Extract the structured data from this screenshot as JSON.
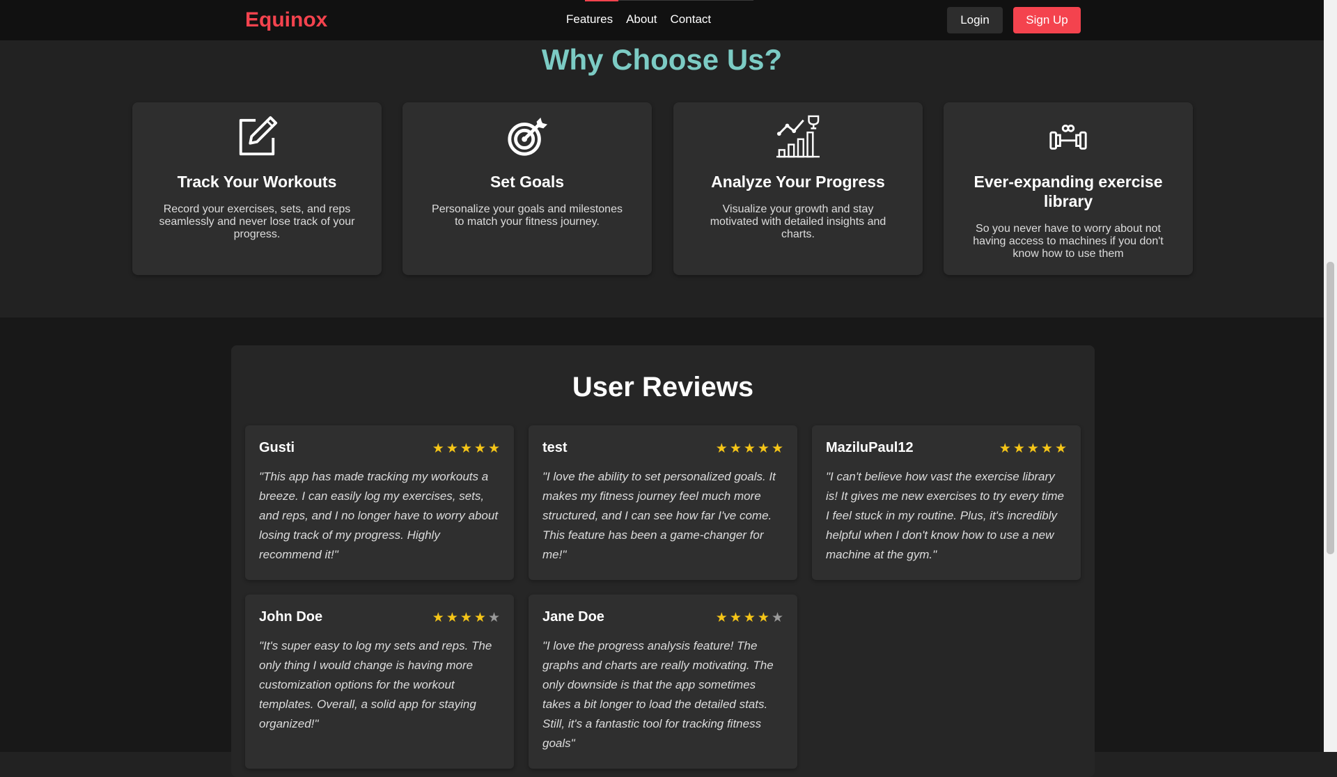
{
  "nav": {
    "brand": "Equinox",
    "links": [
      "Features",
      "About",
      "Contact"
    ],
    "login_label": "Login",
    "signup_label": "Sign Up"
  },
  "features": {
    "title": "Why Choose Us?",
    "cards": [
      {
        "icon": "edit-icon",
        "title": "Track Your Workouts",
        "desc": "Record your exercises, sets, and reps seamlessly and never lose track of your progress."
      },
      {
        "icon": "target-icon",
        "title": "Set Goals",
        "desc": "Personalize your goals and milestones to match your fitness journey."
      },
      {
        "icon": "growth-chart-icon",
        "title": "Analyze Your Progress",
        "desc": "Visualize your growth and stay motivated with detailed insights and charts."
      },
      {
        "icon": "dumbbell-icon",
        "title": "Ever-expanding exercise library",
        "desc": "So you never have to worry about not having access to machines if you don't know how to use them"
      }
    ]
  },
  "reviews": {
    "title": "User Reviews",
    "items": [
      {
        "name": "Gusti",
        "rating": 5,
        "text": "\"This app has made tracking my workouts a breeze. I can easily log my exercises, sets, and reps, and I no longer have to worry about losing track of my progress. Highly recommend it!\""
      },
      {
        "name": "test",
        "rating": 5,
        "text": "\"I love the ability to set personalized goals. It makes my fitness journey feel much more structured, and I can see how far I've come. This feature has been a game-changer for me!\""
      },
      {
        "name": "MaziluPaul12",
        "rating": 5,
        "text": "\"I can't believe how vast the exercise library is! It gives me new exercises to try every time I feel stuck in my routine. Plus, it's incredibly helpful when I don't know how to use a new machine at the gym.\""
      },
      {
        "name": "John Doe",
        "rating": 4,
        "text": "\"It's super easy to log my sets and reps. The only thing I would change is having more customization options for the workout templates. Overall, a solid app for staying organized!\""
      },
      {
        "name": "Jane Doe",
        "rating": 4,
        "text": "\"I love the progress analysis feature! The graphs and charts are really motivating. The only downside is that the app sometimes takes a bit longer to load the detailed stats. Still, it's a fantastic tool for tracking fitness goals\""
      }
    ],
    "max_rating": 5
  },
  "colors": {
    "accent": "#f4434e",
    "heading_teal": "#7ccbc4",
    "star": "#f5c518"
  }
}
